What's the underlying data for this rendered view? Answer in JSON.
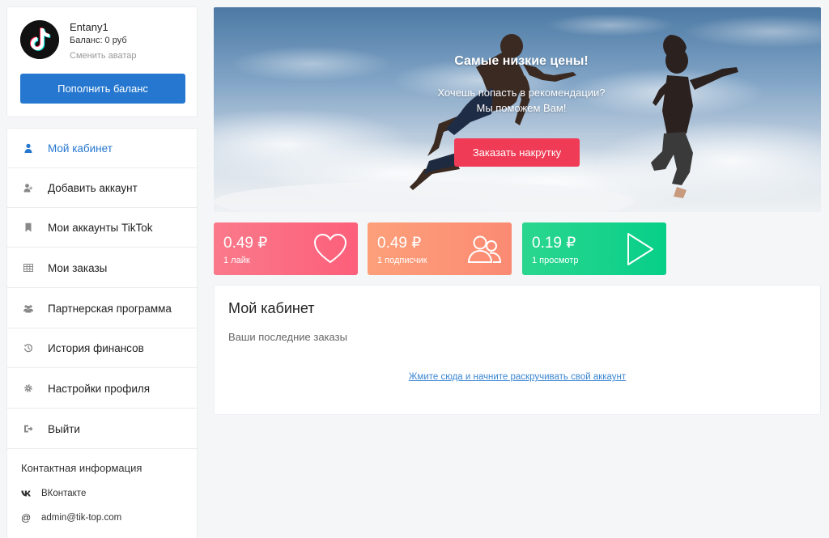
{
  "profile": {
    "username": "Entany1",
    "balance": "Баланс: 0 руб",
    "change_avatar": "Сменить аватар",
    "topup_label": "Пополнить баланс",
    "avatar_icon": "tiktok-logo"
  },
  "nav": {
    "items": [
      {
        "label": "Мой кабинет",
        "icon": "user-icon",
        "active": true
      },
      {
        "label": "Добавить аккаунт",
        "icon": "add-user-icon",
        "active": false
      },
      {
        "label": "Мои аккаунты TikTok",
        "icon": "bookmark-icon",
        "active": false
      },
      {
        "label": "Мои заказы",
        "icon": "table-icon",
        "active": false
      },
      {
        "label": "Партнерская программа",
        "icon": "group-icon",
        "active": false
      },
      {
        "label": "История финансов",
        "icon": "history-icon",
        "active": false
      },
      {
        "label": "Настройки профиля",
        "icon": "gear-icon",
        "active": false
      },
      {
        "label": "Выйти",
        "icon": "logout-icon",
        "active": false
      }
    ]
  },
  "contacts": {
    "title": "Контактная информация",
    "items": [
      {
        "label": "ВКонтакте",
        "icon": "vk-icon"
      },
      {
        "label": "admin@tik-top.com",
        "icon": "at-icon"
      }
    ]
  },
  "banner": {
    "title": "Самые низкие цены!",
    "line1": "Хочешь попасть в рекомендации?",
    "line2": "Мы поможем Вам!",
    "button": "Заказать накрутку"
  },
  "prices": [
    {
      "value": "0.49 ₽",
      "label": "1 лайк",
      "icon": "heart-icon"
    },
    {
      "value": "0.49 ₽",
      "label": "1 подписчик",
      "icon": "users-icon"
    },
    {
      "value": "0.19 ₽",
      "label": "1 просмотр",
      "icon": "play-icon"
    }
  ],
  "main": {
    "title": "Мой кабинет",
    "subtitle": "Ваши последние заказы",
    "link": "Жмите сюда и начните раскручивать свой аккаунт"
  },
  "colors": {
    "accent": "#2577cf",
    "order_button": "#ef3b55",
    "likes_card": "#fc6a80",
    "subscribers_card": "#fd967a",
    "views_card": "#12d28b"
  }
}
